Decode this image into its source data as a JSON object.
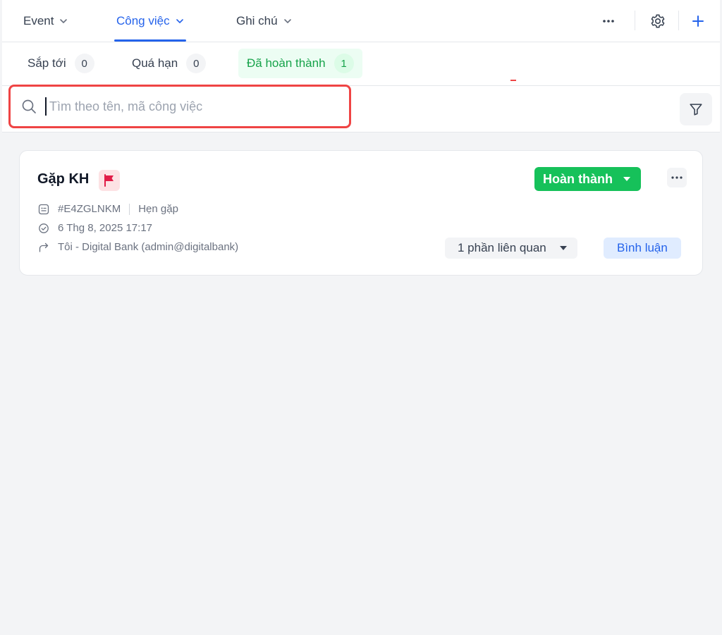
{
  "tabs": [
    {
      "label": "Event"
    },
    {
      "label": "Công việc"
    },
    {
      "label": "Ghi chú"
    }
  ],
  "filters": [
    {
      "label": "Sắp tới",
      "count": "0"
    },
    {
      "label": "Quá hạn",
      "count": "0"
    },
    {
      "label": "Đã hoàn thành",
      "count": "1"
    }
  ],
  "search": {
    "placeholder": "Tìm theo tên, mã công việc",
    "value": ""
  },
  "task": {
    "title": "Gặp KH",
    "status": "Hoàn thành",
    "code": "#E4ZGLNKM",
    "type": "Hẹn gặp",
    "datetime": "6 Thg 8, 2025 17:17",
    "assignee": "Tôi - Digital Bank (admin@digitalbank)",
    "related": "1 phần liên quan",
    "comment": "Bình luận"
  },
  "colors": {
    "accent": "#2563eb",
    "success": "#16c15a",
    "highlight": "#ef4444",
    "flag": "#e11d48"
  }
}
